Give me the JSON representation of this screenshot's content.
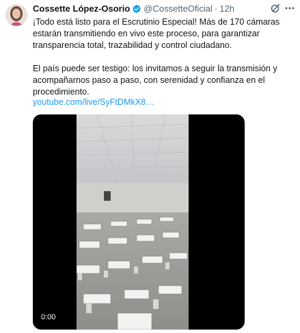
{
  "tweet": {
    "author_name": "Cossette López-Osorio",
    "handle": "@CossetteOficial",
    "separator": "·",
    "time": "12h",
    "paragraphs": [
      "¡Todo está listo para el Escrutinio Especial! Más de 170 cámaras estarán transmitiendo en vivo este proceso, para garantizar transparencia total, trazabilidad y control ciudadano.",
      "El país puede ser testigo: los invitamos a seguir la transmisión y acompañarnos paso a paso, con serenidad y confianza en el procedimiento."
    ],
    "link_text": "youtube.com/live/SyFtDMkX8…",
    "video": {
      "timestamp": "0:00"
    },
    "colors": {
      "verified": "#1d9bf0",
      "link": "#1d9bf0",
      "secondary_text": "#536471"
    },
    "icons": [
      "verified-badge-icon",
      "grok-icon",
      "more-icon"
    ]
  }
}
